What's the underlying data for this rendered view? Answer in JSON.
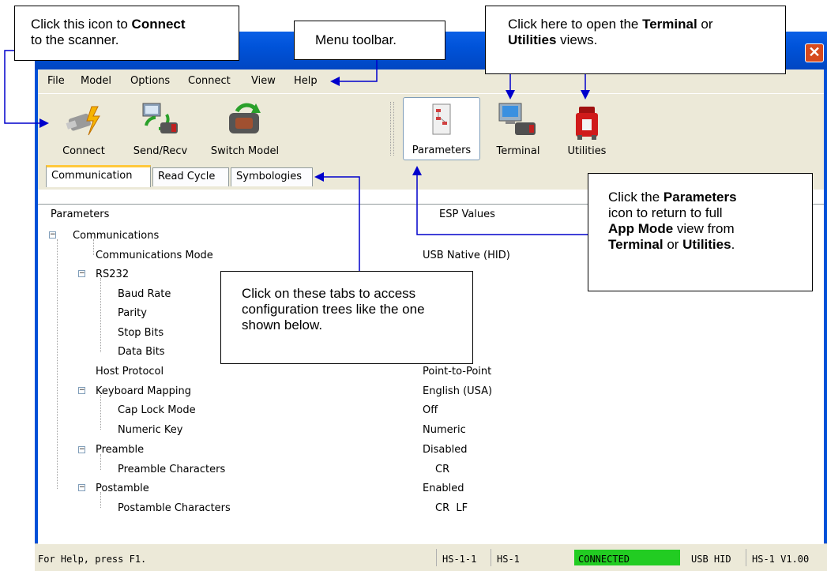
{
  "menu": [
    "File",
    "Model",
    "Options",
    "Connect",
    "View",
    "Help"
  ],
  "toolbar": {
    "connect": "Connect",
    "send_recv": "Send/Recv",
    "switch_model": "Switch Model",
    "parameters": "Parameters",
    "terminal": "Terminal",
    "utilities": "Utilities"
  },
  "tabs": [
    "Communication",
    "Read Cycle",
    "Symbologies"
  ],
  "columns": {
    "parameters": "Parameters",
    "esp_values": "ESP Values"
  },
  "tree": [
    {
      "label": "Communications",
      "value": ""
    },
    {
      "label": "Communications Mode",
      "value": "USB Native (HID)"
    },
    {
      "label": "RS232",
      "value": ""
    },
    {
      "label": "Baud Rate",
      "value": ""
    },
    {
      "label": "Parity",
      "value": ""
    },
    {
      "label": "Stop Bits",
      "value": ""
    },
    {
      "label": "Data Bits",
      "value": ""
    },
    {
      "label": "Host Protocol",
      "value": "Point-to-Point"
    },
    {
      "label": "Keyboard Mapping",
      "value": "English (USA)"
    },
    {
      "label": "Cap Lock Mode",
      "value": "Off"
    },
    {
      "label": "Numeric Key",
      "value": "Numeric"
    },
    {
      "label": "Preamble",
      "value": "Disabled"
    },
    {
      "label": "Preamble Characters",
      "value": "CR"
    },
    {
      "label": "Postamble",
      "value": "Enabled"
    },
    {
      "label": "Postamble Characters",
      "value": "CR  LF"
    }
  ],
  "status": {
    "help": "For Help, press F1.",
    "model_id": "HS-1-1",
    "model": "HS-1",
    "connection": "CONNECTED",
    "interface": "USB HID",
    "version": "HS-1 V1.00",
    "connected_color": "#22cc22"
  },
  "callouts": {
    "connect_pre": "Click this icon to ",
    "connect_bold": "Connect",
    "connect_post": "to the scanner.",
    "menu": "Menu toolbar.",
    "views_pre": "Click here to open the ",
    "views_bold1": "Terminal",
    "views_mid": " or",
    "views_bold2": "Utilities",
    "views_post": " views.",
    "tabs": "Click on these tabs to access configuration trees like the one shown below.",
    "params_pre": "Click the ",
    "params_bold1": "Parameters",
    "params_mid1": "icon to return to full",
    "params_bold2": "App Mode",
    "params_mid2": " view from",
    "params_bold3": "Terminal",
    "params_mid3": " or ",
    "params_bold4": "Utilities",
    "params_post": "."
  },
  "icons": {
    "close": "close-icon",
    "connect": "plug-icon",
    "send_recv": "computer-sync-icon",
    "switch_model": "scanner-switch-icon",
    "parameters": "parameters-icon",
    "terminal": "terminal-icon",
    "utilities": "toolbox-icon"
  }
}
